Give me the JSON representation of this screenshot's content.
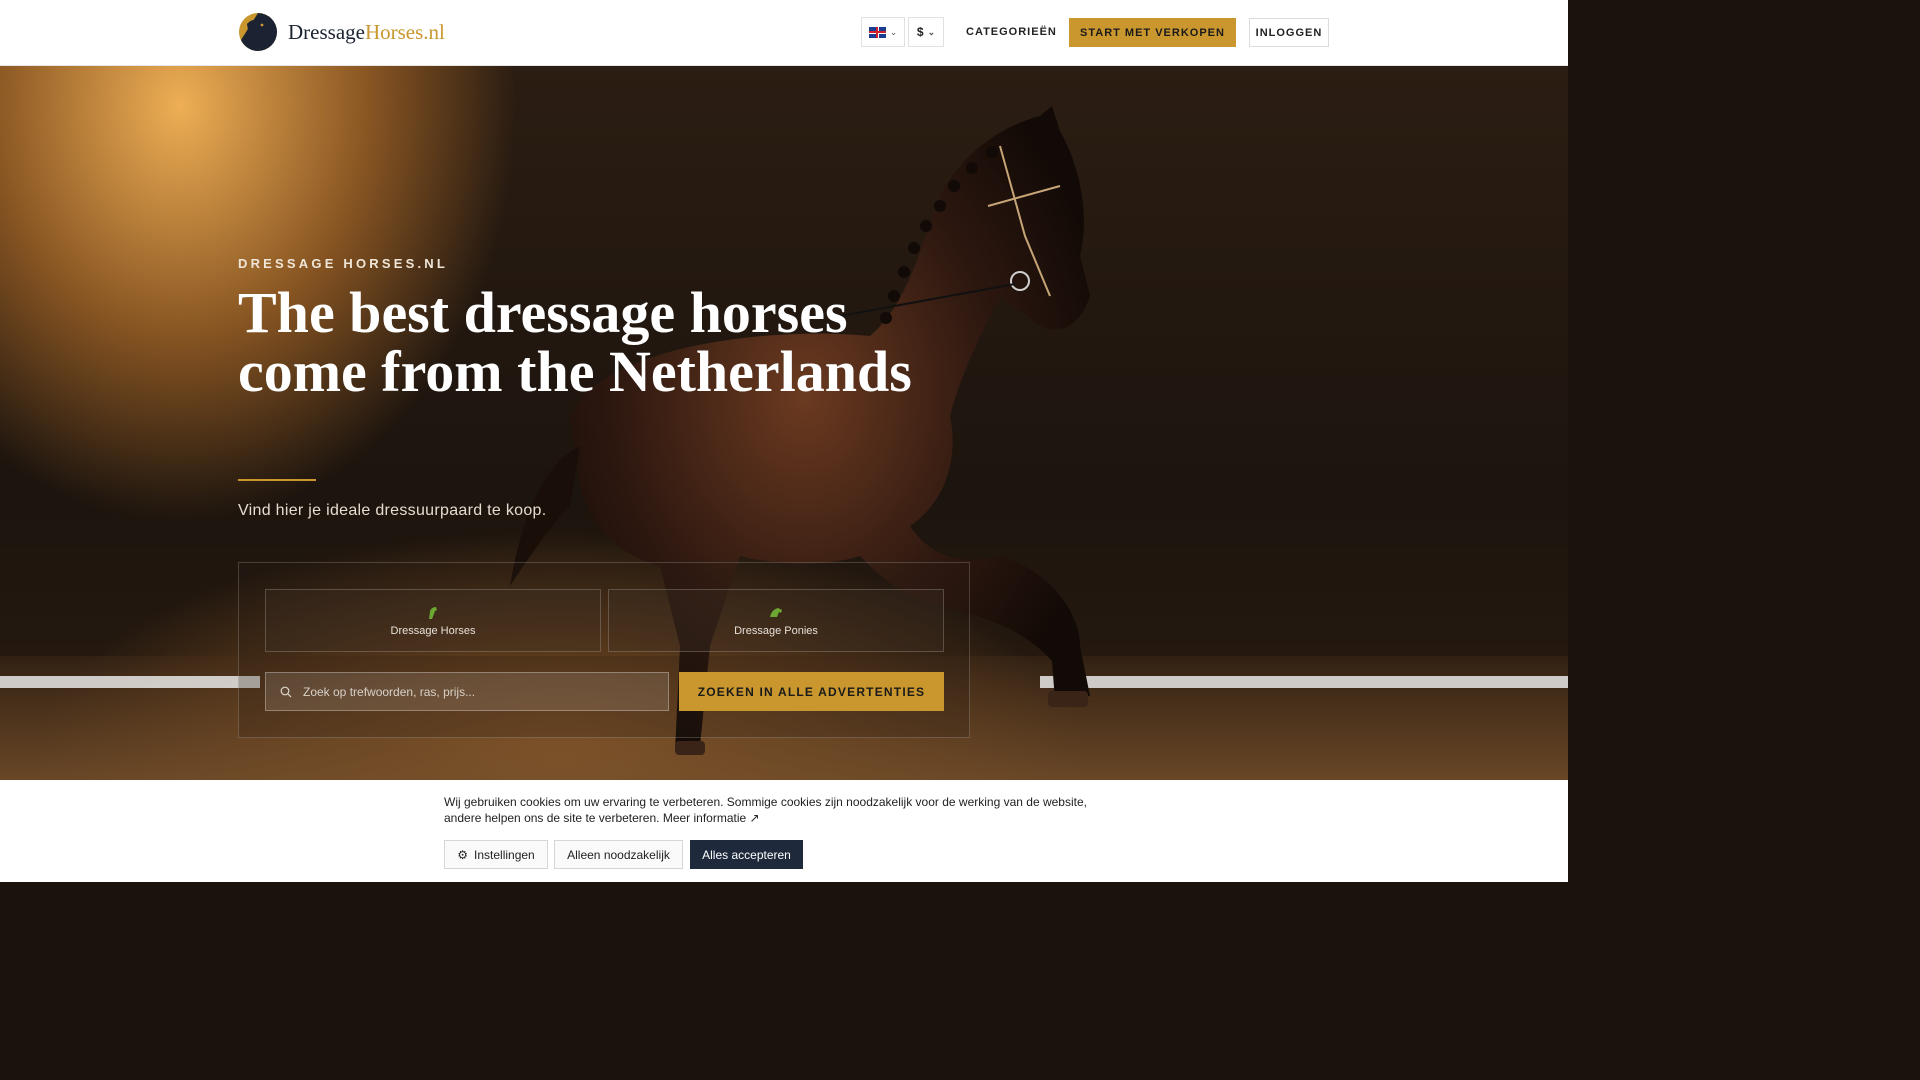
{
  "header": {
    "logo_text_main": "Dressage",
    "logo_text_accent": "Horses.nl",
    "language_flag": "uk-flag-icon",
    "currency": "$",
    "categories_label": "CATEGORIEËN",
    "sell_button": "START MET VERKOPEN",
    "login_button": "INLOGGEN"
  },
  "hero": {
    "kicker": "DRESSAGE HORSES.NL",
    "headline": "The best dressage horses come from the Netherlands",
    "subtitle": "Vind hier je ideale dressuurpaard te koop.",
    "categories": [
      {
        "label": "Dressage Horses",
        "icon": "horse-head-icon"
      },
      {
        "label": "Dressage Ponies",
        "icon": "pony-icon"
      }
    ],
    "search": {
      "placeholder": "Zoek op trefwoorden, ras, prijs...",
      "button": "ZOEKEN IN ALLE ADVERTENTIES"
    }
  },
  "cookie": {
    "text": "Wij gebruiken cookies om uw ervaring te verbeteren. Sommige cookies zijn noodzakelijk voor de werking van de website, andere helpen ons de site te verbeteren.",
    "link": "Meer informatie",
    "settings_button": "Instellingen",
    "necessary_button": "Alleen noodzakelijk",
    "accept_button": "Alles accepteren"
  },
  "colors": {
    "accent": "#c9972e",
    "navy": "#1e2a3b",
    "icon_green": "#6aa832"
  }
}
